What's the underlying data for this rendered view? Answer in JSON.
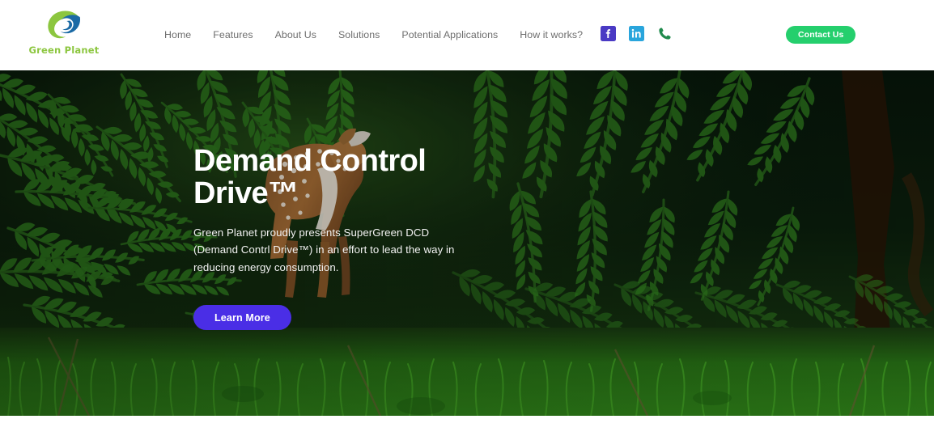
{
  "header": {
    "brand": {
      "name": "Green Planet",
      "logo_icon": "green-planet-swirl-logo",
      "logo_colors": {
        "green": "#8cc63f",
        "blue": "#1b6aa5"
      },
      "text_color": "#8cc63f"
    },
    "nav": [
      {
        "label": "Home",
        "name": "home"
      },
      {
        "label": "Features",
        "name": "features"
      },
      {
        "label": "About Us",
        "name": "about-us"
      },
      {
        "label": "Solutions",
        "name": "solutions"
      },
      {
        "label": "Potential Applications",
        "name": "potential-applications"
      },
      {
        "label": "How it works?",
        "name": "how-it-works"
      }
    ],
    "socials": [
      {
        "name": "facebook",
        "icon": "facebook-icon",
        "color": "#4a3ac4"
      },
      {
        "name": "linkedin",
        "icon": "linkedin-icon",
        "color": "#29a5dc"
      },
      {
        "name": "phone",
        "icon": "phone-icon",
        "color": "#1f8a4c"
      }
    ],
    "contact_button": {
      "label": "Contact Us",
      "bg": "#25cf6d",
      "text_color": "#ffffff"
    },
    "bg": "#ffffff"
  },
  "hero": {
    "background": {
      "description": "dark forest with ferns and a spotted fawn standing in grass",
      "alt": "forest-fern-fawn-photo"
    },
    "title": "Demand Control Drive™",
    "subtitle": "Green Planet proudly presents SuperGreen DCD (Demand Contrl Drive™) in an effort to lead the way in reducing energy consumption.",
    "cta": {
      "label": "Learn More",
      "bg": "#4a2ee6",
      "text_color": "#ffffff"
    },
    "title_color": "#ffffff"
  }
}
